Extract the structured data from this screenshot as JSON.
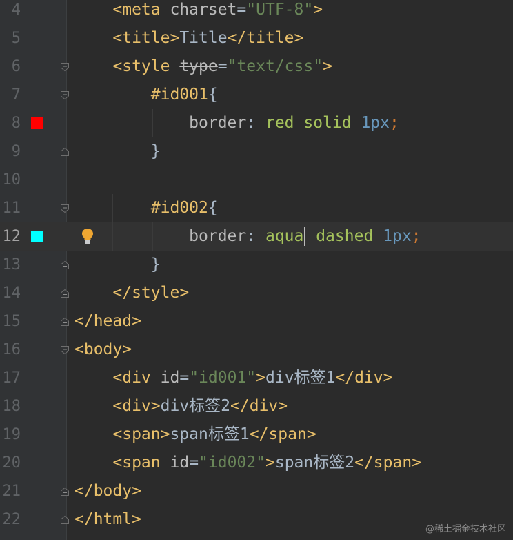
{
  "editor": {
    "colors": {
      "background": "#2b2b2b",
      "gutter": "#313335",
      "tag": "#e8bf6a",
      "string": "#6a8759",
      "number": "#6897bb",
      "keyword_punctuation": "#cc7832"
    },
    "lines": [
      {
        "num": "4",
        "tokens": [
          {
            "t": "    ",
            "c": "txt"
          },
          {
            "t": "<meta ",
            "c": "tag"
          },
          {
            "t": "charset",
            "c": "attr"
          },
          {
            "t": "=",
            "c": "txt"
          },
          {
            "t": "\"UTF-8\"",
            "c": "str"
          },
          {
            "t": ">",
            "c": "tag"
          }
        ]
      },
      {
        "num": "5",
        "tokens": [
          {
            "t": "    ",
            "c": "txt"
          },
          {
            "t": "<title>",
            "c": "tag"
          },
          {
            "t": "Title",
            "c": "txt"
          },
          {
            "t": "</title>",
            "c": "tag"
          }
        ]
      },
      {
        "num": "6",
        "tokens": [
          {
            "t": "    ",
            "c": "txt"
          },
          {
            "t": "<style ",
            "c": "tag"
          },
          {
            "t": "type",
            "c": "strike"
          },
          {
            "t": "=",
            "c": "txt"
          },
          {
            "t": "\"text/css\"",
            "c": "str"
          },
          {
            "t": ">",
            "c": "tag"
          }
        ]
      },
      {
        "num": "7",
        "tokens": [
          {
            "t": "        ",
            "c": "txt"
          },
          {
            "t": "#id001",
            "c": "sel"
          },
          {
            "t": "{",
            "c": "brace"
          }
        ]
      },
      {
        "num": "8",
        "tokens": [
          {
            "t": "            ",
            "c": "txt"
          },
          {
            "t": "border",
            "c": "prop"
          },
          {
            "t": ": ",
            "c": "txt"
          },
          {
            "t": "red solid ",
            "c": "val"
          },
          {
            "t": "1px",
            "c": "num"
          },
          {
            "t": ";",
            "c": "punc"
          }
        ]
      },
      {
        "num": "9",
        "tokens": [
          {
            "t": "        ",
            "c": "txt"
          },
          {
            "t": "}",
            "c": "brace"
          }
        ]
      },
      {
        "num": "10",
        "tokens": []
      },
      {
        "num": "11",
        "tokens": [
          {
            "t": "        ",
            "c": "txt"
          },
          {
            "t": "#id002",
            "c": "sel"
          },
          {
            "t": "{",
            "c": "brace"
          }
        ]
      },
      {
        "num": "12",
        "tokens": [
          {
            "t": "            ",
            "c": "txt"
          },
          {
            "t": "border",
            "c": "prop"
          },
          {
            "t": ": ",
            "c": "txt"
          },
          {
            "t": "aqua",
            "c": "val"
          },
          {
            "t": "|",
            "c": "cursor"
          },
          {
            "t": " dashed ",
            "c": "val"
          },
          {
            "t": "1px",
            "c": "num"
          },
          {
            "t": ";",
            "c": "punc"
          }
        ]
      },
      {
        "num": "13",
        "tokens": [
          {
            "t": "        ",
            "c": "txt"
          },
          {
            "t": "}",
            "c": "brace"
          }
        ]
      },
      {
        "num": "14",
        "tokens": [
          {
            "t": "    ",
            "c": "txt"
          },
          {
            "t": "</style>",
            "c": "tag"
          }
        ]
      },
      {
        "num": "15",
        "tokens": [
          {
            "t": "</head>",
            "c": "tag"
          }
        ]
      },
      {
        "num": "16",
        "tokens": [
          {
            "t": "<body>",
            "c": "tag"
          }
        ]
      },
      {
        "num": "17",
        "tokens": [
          {
            "t": "    ",
            "c": "txt"
          },
          {
            "t": "<div ",
            "c": "tag"
          },
          {
            "t": "id",
            "c": "attr"
          },
          {
            "t": "=",
            "c": "txt"
          },
          {
            "t": "\"id001\"",
            "c": "str"
          },
          {
            "t": ">",
            "c": "tag"
          },
          {
            "t": "div标签1",
            "c": "txt"
          },
          {
            "t": "</div>",
            "c": "tag"
          }
        ]
      },
      {
        "num": "18",
        "tokens": [
          {
            "t": "    ",
            "c": "txt"
          },
          {
            "t": "<div>",
            "c": "tag"
          },
          {
            "t": "div标签2",
            "c": "txt"
          },
          {
            "t": "</div>",
            "c": "tag"
          }
        ]
      },
      {
        "num": "19",
        "tokens": [
          {
            "t": "    ",
            "c": "txt"
          },
          {
            "t": "<span>",
            "c": "tag"
          },
          {
            "t": "span标签1",
            "c": "txt"
          },
          {
            "t": "</span>",
            "c": "tag"
          }
        ]
      },
      {
        "num": "20",
        "tokens": [
          {
            "t": "    ",
            "c": "txt"
          },
          {
            "t": "<span ",
            "c": "tag"
          },
          {
            "t": "id",
            "c": "attr"
          },
          {
            "t": "=",
            "c": "txt"
          },
          {
            "t": "\"id002\"",
            "c": "str"
          },
          {
            "t": ">",
            "c": "tag"
          },
          {
            "t": "span标签2",
            "c": "txt"
          },
          {
            "t": "</span>",
            "c": "tag"
          }
        ]
      },
      {
        "num": "21",
        "tokens": [
          {
            "t": "</body>",
            "c": "tag"
          }
        ]
      },
      {
        "num": "22",
        "tokens": [
          {
            "t": "</html>",
            "c": "tag"
          }
        ]
      }
    ],
    "current_line": "12",
    "color_swatches": [
      {
        "line": "8",
        "color": "#ff0000",
        "icon": "red-color-swatch-icon"
      },
      {
        "line": "12",
        "color": "#00ffff",
        "icon": "aqua-color-swatch-icon"
      }
    ],
    "fold_markers": [
      {
        "line": "6",
        "kind": "open"
      },
      {
        "line": "7",
        "kind": "open"
      },
      {
        "line": "9",
        "kind": "close"
      },
      {
        "line": "11",
        "kind": "open"
      },
      {
        "line": "13",
        "kind": "close"
      },
      {
        "line": "14",
        "kind": "close"
      },
      {
        "line": "15",
        "kind": "close"
      },
      {
        "line": "16",
        "kind": "open"
      },
      {
        "line": "21",
        "kind": "close"
      },
      {
        "line": "22",
        "kind": "close"
      }
    ],
    "intention_bulb": {
      "line": "12",
      "icon": "lightbulb-icon",
      "color": "#f0a732"
    }
  },
  "watermark": "@稀土掘金技术社区"
}
